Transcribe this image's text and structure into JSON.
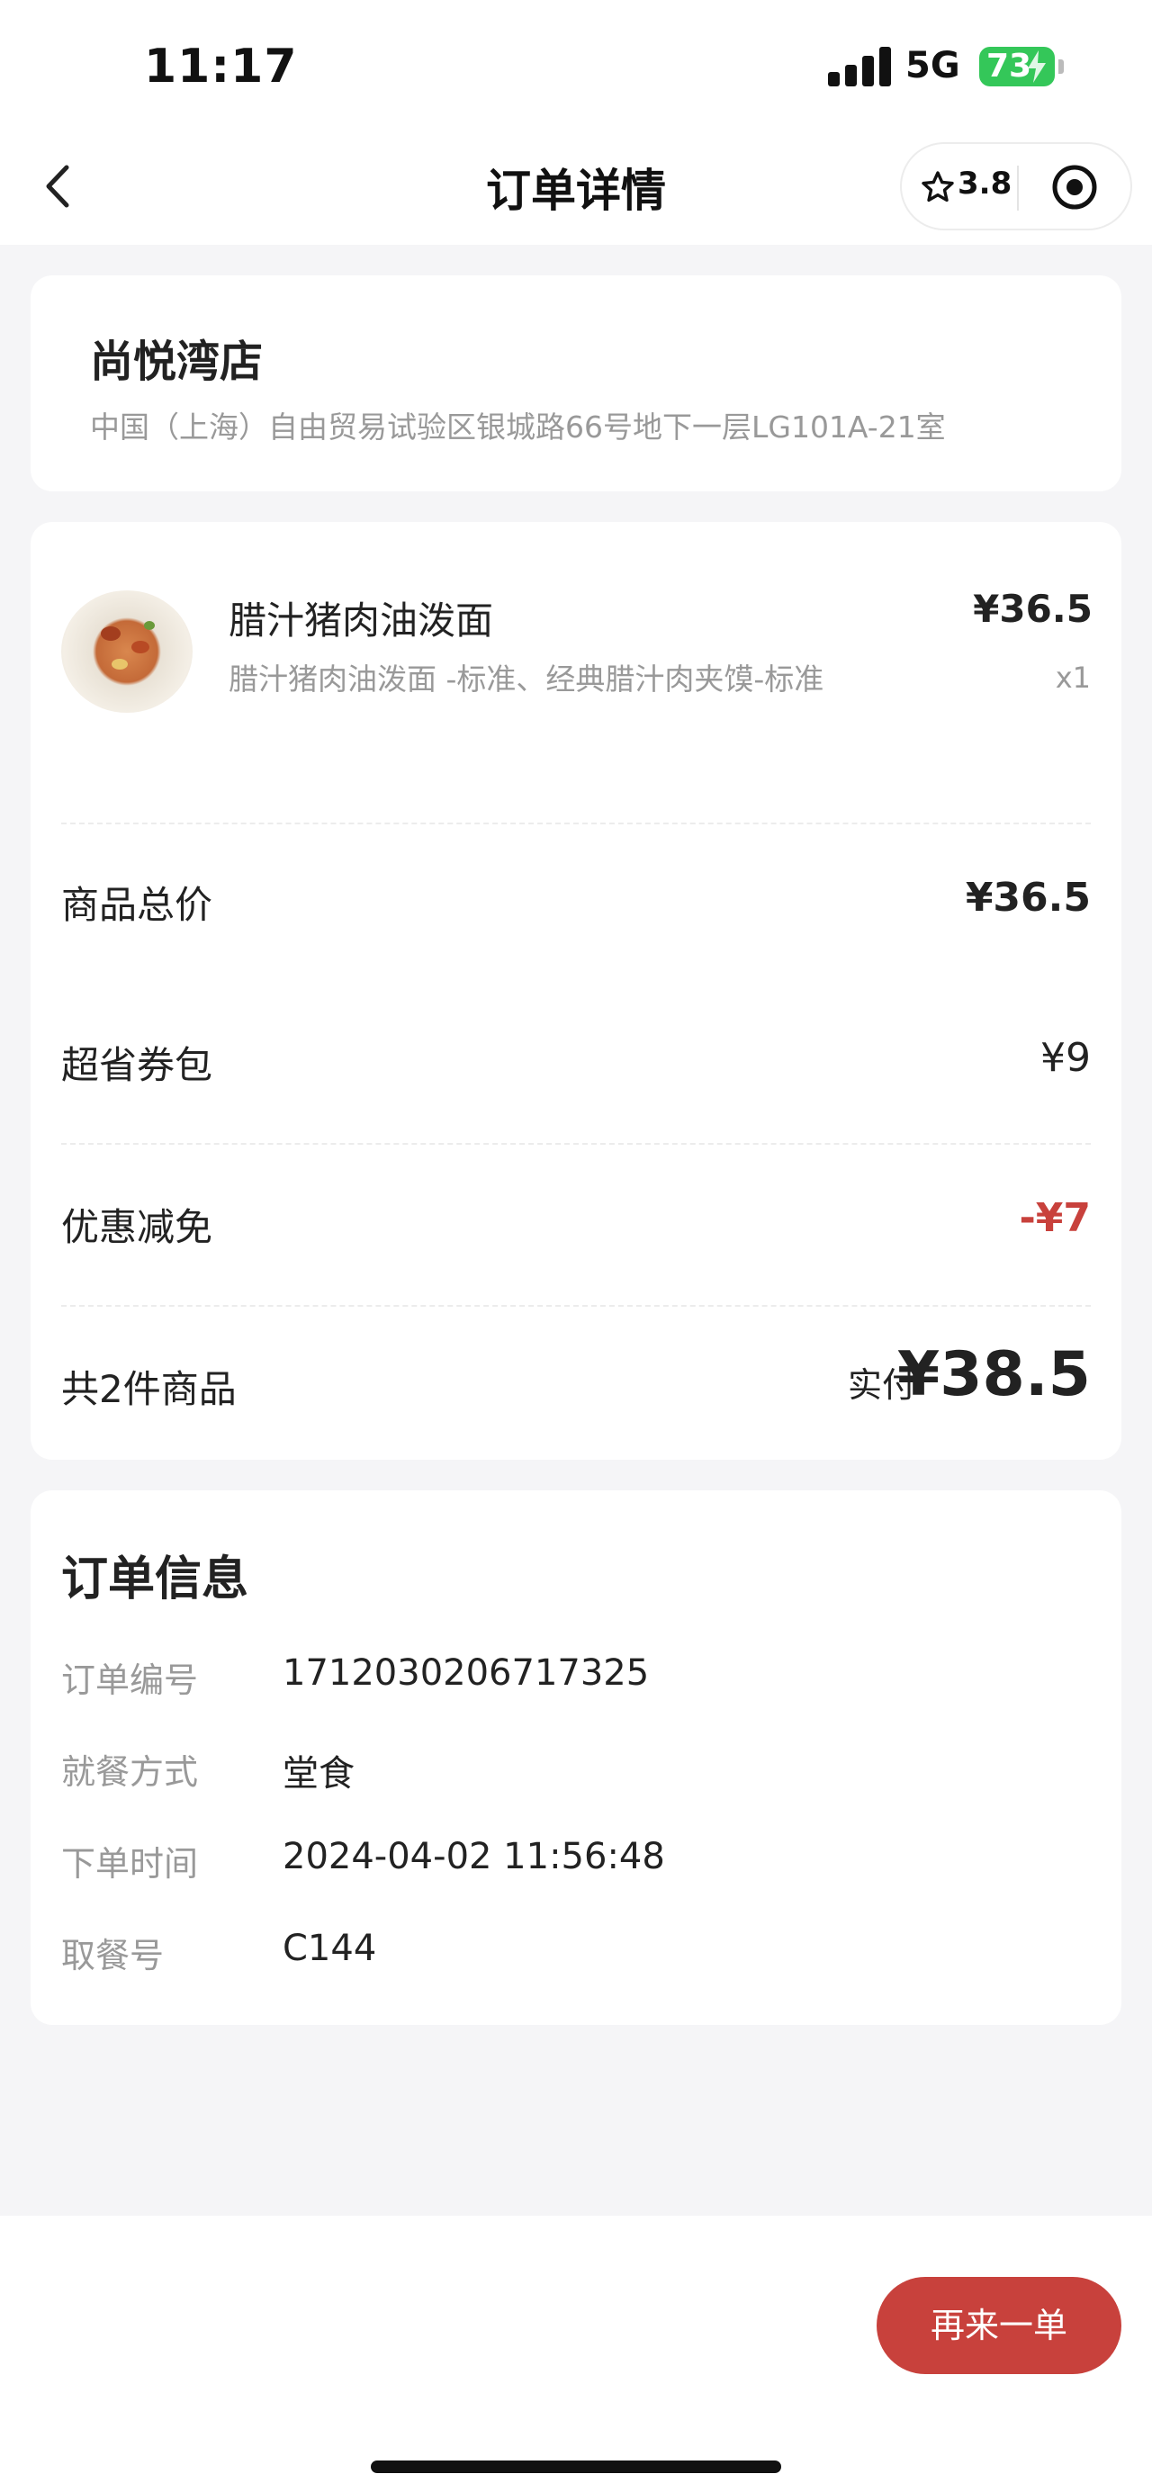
{
  "status_bar": {
    "time": "11:17",
    "network": "5G",
    "battery": "73"
  },
  "nav": {
    "title": "订单详情",
    "rating": "3.8"
  },
  "store": {
    "name": "尚悦湾店",
    "address": "中国（上海）自由贸易试验区银城路66号地下一层LG101A-21室"
  },
  "items": [
    {
      "name": "腊汁猪肉油泼面",
      "desc": "腊汁猪肉油泼面 -标准、经典腊汁肉夹馍-标准",
      "price": "¥36.5",
      "qty": "x1",
      "image_icon": "noodle-dish-photo"
    }
  ],
  "summary": {
    "subtotal_label": "商品总价",
    "subtotal_value": "¥36.5",
    "coupon_label": "超省券包",
    "coupon_value": "¥9",
    "discount_label": "优惠减免",
    "discount_value": "-¥7",
    "count_label": "共2件商品",
    "paid_label": "实付",
    "paid_value": "¥38.5"
  },
  "order_info": {
    "title": "订单信息",
    "rows": [
      {
        "label": "订单编号",
        "value": "1712030206717325"
      },
      {
        "label": "就餐方式",
        "value": "堂食"
      },
      {
        "label": "下单时间",
        "value": "2024-04-02 11:56:48"
      },
      {
        "label": "取餐号",
        "value": "C144"
      }
    ]
  },
  "footer": {
    "again_label": "再来一单"
  },
  "colors": {
    "accent": "#c8413c",
    "battery": "#34c759",
    "background": "#f5f5f7"
  }
}
